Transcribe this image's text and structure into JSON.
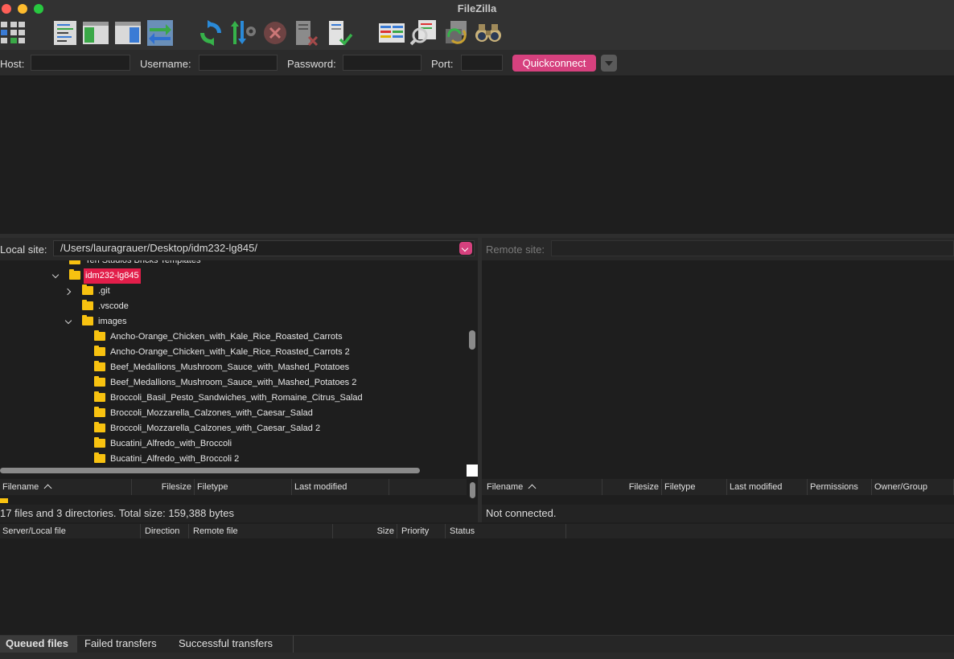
{
  "window": {
    "title": "FileZilla"
  },
  "toolbar": {
    "buttons": [
      {
        "name": "site-manager-icon"
      },
      {
        "name": "message-log-toggle-icon"
      },
      {
        "name": "local-tree-toggle-icon"
      },
      {
        "name": "remote-tree-toggle-icon"
      },
      {
        "name": "transfer-queue-toggle-icon"
      },
      {
        "name": "refresh-icon"
      },
      {
        "name": "process-queue-icon"
      },
      {
        "name": "cancel-operation-icon"
      },
      {
        "name": "disconnect-icon"
      },
      {
        "name": "reconnect-icon"
      },
      {
        "name": "directory-comparison-icon"
      },
      {
        "name": "filename-filter-icon"
      },
      {
        "name": "synchronized-browsing-icon"
      },
      {
        "name": "search-files-icon"
      }
    ]
  },
  "quickconnect": {
    "host_label": "Host:",
    "host_value": "",
    "username_label": "Username:",
    "username_value": "",
    "password_label": "Password:",
    "password_value": "",
    "port_label": "Port:",
    "port_value": "",
    "button_label": "Quickconnect"
  },
  "local": {
    "site_label": "Local site:",
    "path": "/Users/lauragrauer/Desktop/idm232-lg845/",
    "tree": {
      "partial_row": "Ten Studios Bricks Templates",
      "selected_folder": "idm232-lg845",
      "children": [
        ".git",
        ".vscode",
        "images"
      ],
      "image_folders": [
        "Ancho-Orange_Chicken_with_Kale_Rice_Roasted_Carrots",
        "Ancho-Orange_Chicken_with_Kale_Rice_Roasted_Carrots 2",
        "Beef_Medallions_Mushroom_Sauce_with_Mashed_Potatoes",
        "Beef_Medallions_Mushroom_Sauce_with_Mashed_Potatoes 2",
        "Broccoli_Basil_Pesto_Sandwiches_with_Romaine_Citrus_Salad",
        "Broccoli_Mozzarella_Calzones_with_Caesar_Salad",
        "Broccoli_Mozzarella_Calzones_with_Caesar_Salad 2",
        "Bucatini_Alfredo_with_Broccoli",
        "Bucatini_Alfredo_with_Broccoli 2"
      ]
    },
    "columns": [
      "Filename",
      "Filesize",
      "Filetype",
      "Last modified"
    ],
    "status": "17 files and 3 directories. Total size: 159,388 bytes"
  },
  "remote": {
    "site_label": "Remote site:",
    "path": "",
    "columns": [
      "Filename",
      "Filesize",
      "Filetype",
      "Last modified",
      "Permissions",
      "Owner/Group"
    ],
    "status": "Not connected."
  },
  "queue": {
    "columns": [
      "Server/Local file",
      "Direction",
      "Remote file",
      "Size",
      "Priority",
      "Status"
    ],
    "tabs": [
      "Queued files",
      "Failed transfers",
      "Successful transfers"
    ],
    "active_tab": "Queued files"
  },
  "colors": {
    "accent": "#d6417e",
    "selection": "#e21e4a",
    "folder": "#f8c210",
    "background": "#1e1e1e"
  }
}
